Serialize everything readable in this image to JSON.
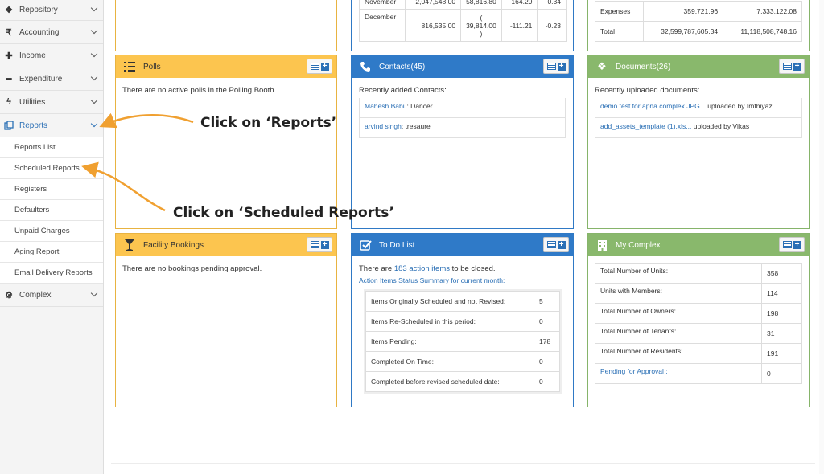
{
  "sidebar": {
    "items": [
      {
        "label": "Repository",
        "icon": "dropbox-icon"
      },
      {
        "label": "Accounting",
        "icon": "rupee-icon"
      },
      {
        "label": "Income",
        "icon": "plus-icon"
      },
      {
        "label": "Expenditure",
        "icon": "minus-icon"
      },
      {
        "label": "Utilities",
        "icon": "bolt-icon"
      },
      {
        "label": "Reports",
        "icon": "reports-icon"
      }
    ],
    "sub_items": [
      "Reports List",
      "Scheduled Reports",
      "Registers",
      "Defaulters",
      "Unpaid Charges",
      "Aging Report",
      "Email Delivery Reports"
    ],
    "last_item": {
      "label": "Complex",
      "icon": "gear-icon"
    }
  },
  "top_mid_table": {
    "rows": [
      [
        "November",
        "2,047,548.00",
        "58,816.80",
        "164.29",
        "0.34"
      ],
      [
        "December",
        "816,535.00",
        "( 39,814.00 )",
        "-111.21",
        "-0.23"
      ]
    ]
  },
  "top_right_table": {
    "rows": [
      [
        "Expenses",
        "359,721.96",
        "7,333,122.08"
      ],
      [
        "Total",
        "32,599,787,605.34",
        "11,118,508,748.16"
      ]
    ]
  },
  "polls": {
    "title": "Polls",
    "text": "There are no active polls in the Polling Booth."
  },
  "contacts": {
    "title": "Contacts(45)",
    "subtitle": "Recently added Contacts:",
    "items": [
      {
        "name": "Mahesh Babu",
        "role": ": Dancer"
      },
      {
        "name": "arvind singh",
        "role": ": tresaure"
      }
    ]
  },
  "documents": {
    "title": "Documents(26)",
    "subtitle": "Recently uploaded documents:",
    "items": [
      {
        "name": "demo test for apna complex.JPG...",
        "by": " uploaded by Imthiyaz"
      },
      {
        "name": "add_assets_template (1).xls...",
        "by": " uploaded by Vikas"
      }
    ]
  },
  "facility": {
    "title": "Facility Bookings",
    "text": "There are no bookings pending approval."
  },
  "todo": {
    "title": "To Do List",
    "line_pre": "There are ",
    "line_link": "183 action items",
    "line_post": " to be closed.",
    "summary": "Action Items Status Summary for current month:",
    "rows": [
      [
        "Items Originally Scheduled and not Revised:",
        "5"
      ],
      [
        "Items Re-Scheduled in this period:",
        "0"
      ],
      [
        "Items Pending:",
        "178"
      ],
      [
        "Completed On Time:",
        "0"
      ],
      [
        "Completed before revised scheduled date:",
        "0"
      ]
    ]
  },
  "complex": {
    "title": "My Complex",
    "rows": [
      [
        "Total Number of Units:",
        "358"
      ],
      [
        "Units with Members:",
        "114"
      ],
      [
        "Total Number of Owners:",
        "198"
      ],
      [
        "Total Number of Tenants:",
        "31"
      ],
      [
        "Total Number of Residents:",
        "191"
      ],
      [
        "Pending for Approval :",
        "0"
      ]
    ]
  },
  "annotations": {
    "reports": "Click on ‘Reports’",
    "scheduled": "Click on ‘Scheduled Reports’"
  },
  "colors": {
    "accent_blue": "#2f7ac8",
    "yellow": "#fcc54f",
    "green": "#89b86c",
    "arrow": "#f0a030"
  }
}
